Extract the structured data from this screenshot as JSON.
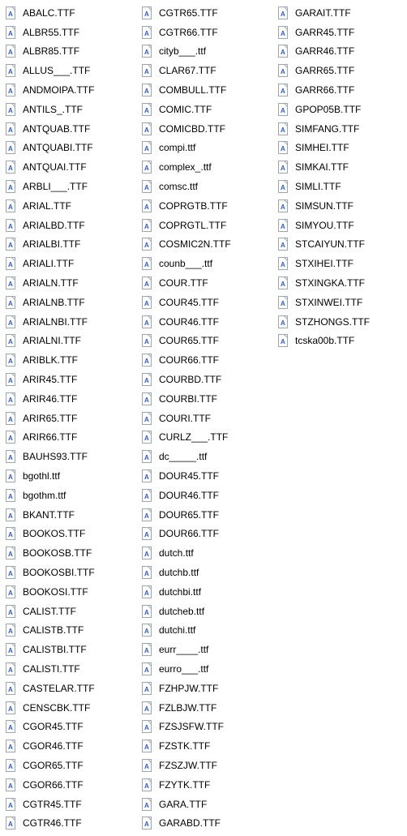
{
  "columns": [
    [
      "ABALC.TTF",
      "ALBR55.TTF",
      "ALBR85.TTF",
      "ALLUS___.TTF",
      "ANDMOIPA.TTF",
      "ANTILS_.TTF",
      "ANTQUAB.TTF",
      "ANTQUABI.TTF",
      "ANTQUAI.TTF",
      "ARBLI___.TTF",
      "ARIAL.TTF",
      "ARIALBD.TTF",
      "ARIALBI.TTF",
      "ARIALI.TTF",
      "ARIALN.TTF",
      "ARIALNB.TTF",
      "ARIALNBI.TTF",
      "ARIALNI.TTF",
      "ARIBLK.TTF",
      "ARIR45.TTF",
      "ARIR46.TTF",
      "ARIR65.TTF",
      "ARIR66.TTF",
      "BAUHS93.TTF",
      "bgothl.ttf",
      "bgothm.ttf",
      "BKANT.TTF",
      "BOOKOS.TTF",
      "BOOKOSB.TTF",
      "BOOKOSBI.TTF",
      "BOOKOSI.TTF",
      "CALIST.TTF",
      "CALISTB.TTF",
      "CALISTBI.TTF",
      "CALISTI.TTF",
      "CASTELAR.TTF",
      "CENSCBK.TTF",
      "CGOR45.TTF",
      "CGOR46.TTF",
      "CGOR65.TTF",
      "CGOR66.TTF",
      "CGTR45.TTF",
      "CGTR46.TTF"
    ],
    [
      "CGTR65.TTF",
      "CGTR66.TTF",
      "cityb___.ttf",
      "CLAR67.TTF",
      "COMBULL.TTF",
      "COMIC.TTF",
      "COMICBD.TTF",
      "compi.ttf",
      "complex_.ttf",
      "comsc.ttf",
      "COPRGTB.TTF",
      "COPRGTL.TTF",
      "COSMIC2N.TTF",
      "counb___.ttf",
      "COUR.TTF",
      "COUR45.TTF",
      "COUR46.TTF",
      "COUR65.TTF",
      "COUR66.TTF",
      "COURBD.TTF",
      "COURBI.TTF",
      "COURI.TTF",
      "CURLZ___.TTF",
      "dc_____.ttf",
      "DOUR45.TTF",
      "DOUR46.TTF",
      "DOUR65.TTF",
      "DOUR66.TTF",
      "dutch.ttf",
      "dutchb.ttf",
      "dutchbi.ttf",
      "dutcheb.ttf",
      "dutchi.ttf",
      "eurr____.ttf",
      "eurro___.ttf",
      "FZHPJW.TTF",
      "FZLBJW.TTF",
      "FZSJSFW.TTF",
      "FZSTK.TTF",
      "FZSZJW.TTF",
      "FZYTK.TTF",
      "GARA.TTF",
      "GARABD.TTF"
    ],
    [
      "GARAIT.TTF",
      "GARR45.TTF",
      "GARR46.TTF",
      "GARR65.TTF",
      "GARR66.TTF",
      "GPOP05B.TTF",
      "SIMFANG.TTF",
      "SIMHEI.TTF",
      "SIMKAI.TTF",
      "SIMLI.TTF",
      "SIMSUN.TTF",
      "SIMYOU.TTF",
      "STCAIYUN.TTF",
      "STXIHEI.TTF",
      "STXINGKA.TTF",
      "STXINWEI.TTF",
      "STZHONGS.TTF",
      "tcska00b.TTF"
    ]
  ]
}
